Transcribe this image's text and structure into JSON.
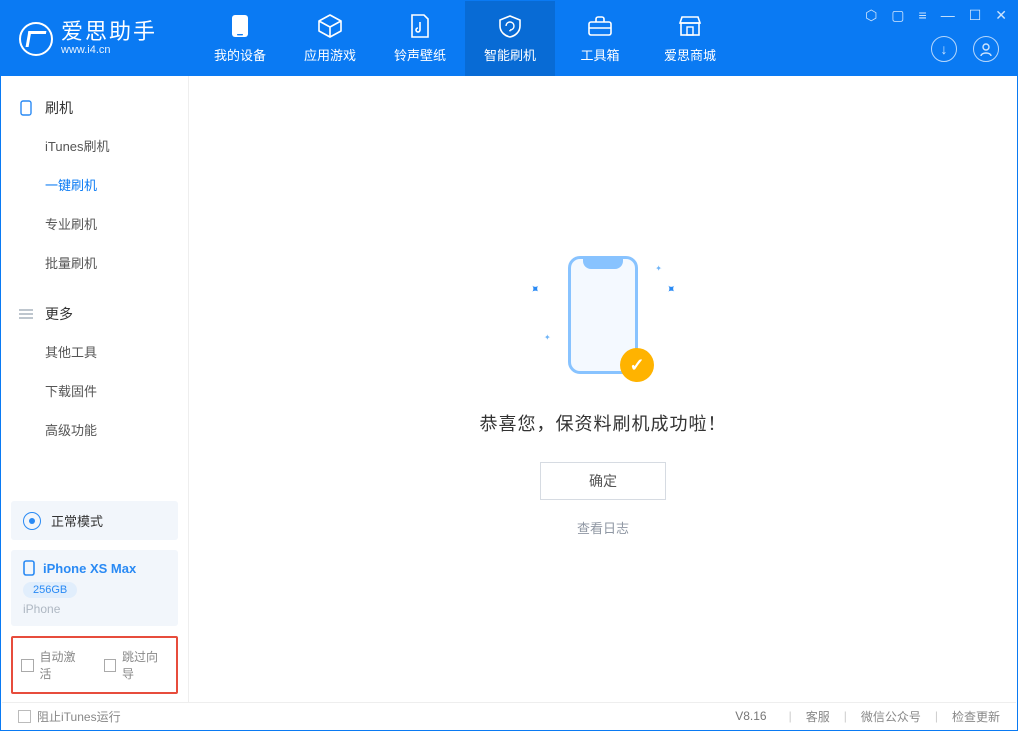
{
  "brand": {
    "name": "爱思助手",
    "url": "www.i4.cn"
  },
  "nav": {
    "tabs": [
      {
        "label": "我的设备"
      },
      {
        "label": "应用游戏"
      },
      {
        "label": "铃声壁纸"
      },
      {
        "label": "智能刷机"
      },
      {
        "label": "工具箱"
      },
      {
        "label": "爱思商城"
      }
    ],
    "active_index": 3
  },
  "sidebar": {
    "groups": [
      {
        "title": "刷机",
        "items": [
          {
            "label": "iTunes刷机"
          },
          {
            "label": "一键刷机"
          },
          {
            "label": "专业刷机"
          },
          {
            "label": "批量刷机"
          }
        ],
        "active_index": 1
      },
      {
        "title": "更多",
        "items": [
          {
            "label": "其他工具"
          },
          {
            "label": "下载固件"
          },
          {
            "label": "高级功能"
          }
        ]
      }
    ],
    "mode_label": "正常模式",
    "device": {
      "name": "iPhone XS Max",
      "storage": "256GB",
      "type": "iPhone"
    },
    "checkboxes": {
      "auto_activate": "自动激活",
      "skip_guide": "跳过向导"
    }
  },
  "main": {
    "success_text": "恭喜您，保资料刷机成功啦！",
    "ok_button": "确定",
    "view_log": "查看日志"
  },
  "footer": {
    "block_itunes": "阻止iTunes运行",
    "version": "V8.16",
    "links": [
      "客服",
      "微信公众号",
      "检查更新"
    ]
  },
  "colors": {
    "primary": "#0a7af3",
    "accent": "#ffb300",
    "highlight_border": "#e74c3c"
  }
}
